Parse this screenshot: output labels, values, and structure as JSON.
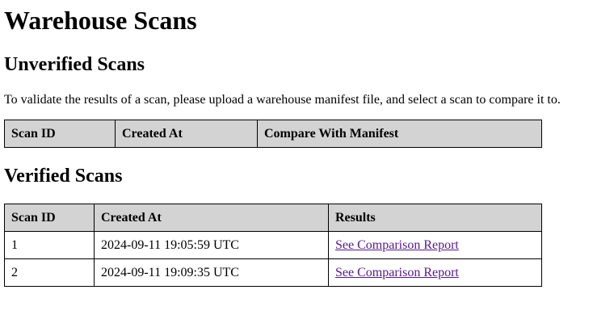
{
  "page": {
    "title": "Warehouse Scans"
  },
  "unverified": {
    "heading": "Unverified Scans",
    "instructions": "To validate the results of a scan, please upload a warehouse manifest file, and select a scan to compare it to.",
    "columns": [
      "Scan ID",
      "Created At",
      "Compare With Manifest"
    ]
  },
  "verified": {
    "heading": "Verified Scans",
    "columns": [
      "Scan ID",
      "Created At",
      "Results"
    ],
    "rows": [
      {
        "scan_id": "1",
        "created_at": "2024-09-11 19:05:59 UTC",
        "result_link": "See Comparison Report"
      },
      {
        "scan_id": "2",
        "created_at": "2024-09-11 19:09:35 UTC",
        "result_link": "See Comparison Report"
      }
    ]
  },
  "colors": {
    "header_bg": "#d3d3d3",
    "visited_link": "#551a8b",
    "border": "#000000"
  }
}
